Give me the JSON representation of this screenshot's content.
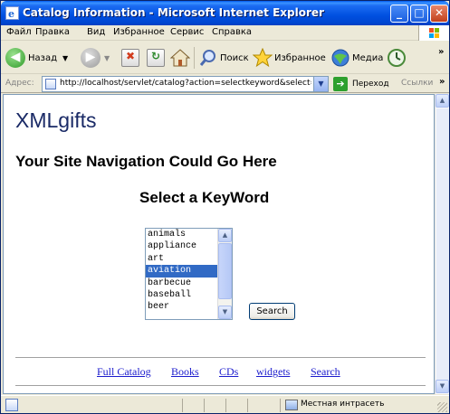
{
  "window": {
    "title": "Catalog Information - Microsoft Internet Explorer",
    "controls": {
      "minimize": "_",
      "maximize": "□",
      "close": "✕"
    }
  },
  "menu": [
    "Файл",
    "Правка",
    "Вид",
    "Избранное",
    "Сервис",
    "Справка"
  ],
  "toolbar": {
    "back_label": "Назад",
    "search_label": "Поиск",
    "favorites_label": "Избранное",
    "media_label": "Медиа"
  },
  "address": {
    "label": "Адрес:",
    "url": "http://localhost/servlet/catalog?action=selectkeyword&select=all",
    "go_label": "Переход",
    "links_label": "Ссылки"
  },
  "page": {
    "brand": "XMLgifts",
    "nav_placeholder": "Your Site Navigation Could Go Here",
    "heading": "Select a KeyWord",
    "keywords": [
      "animals",
      "appliance",
      "art",
      "aviation",
      "barbecue",
      "baseball",
      "beer"
    ],
    "selected_keyword": "aviation",
    "search_button": "Search",
    "footer_links": [
      "Full Catalog",
      "Books",
      "CDs",
      "widgets",
      "Search"
    ]
  },
  "status": {
    "zone": "Местная интрасеть"
  },
  "colors": {
    "titlebar": "#0050e0",
    "brand_text": "#1a2a66",
    "link": "#1b1bcd",
    "selection": "#316ac5"
  },
  "icons": [
    "ie-icon",
    "back-arrow-icon",
    "forward-arrow-icon",
    "stop-icon",
    "refresh-icon",
    "home-icon",
    "search-icon",
    "favorites-star-icon",
    "media-icon",
    "history-icon",
    "page-icon",
    "go-arrow-icon",
    "intranet-icon"
  ]
}
